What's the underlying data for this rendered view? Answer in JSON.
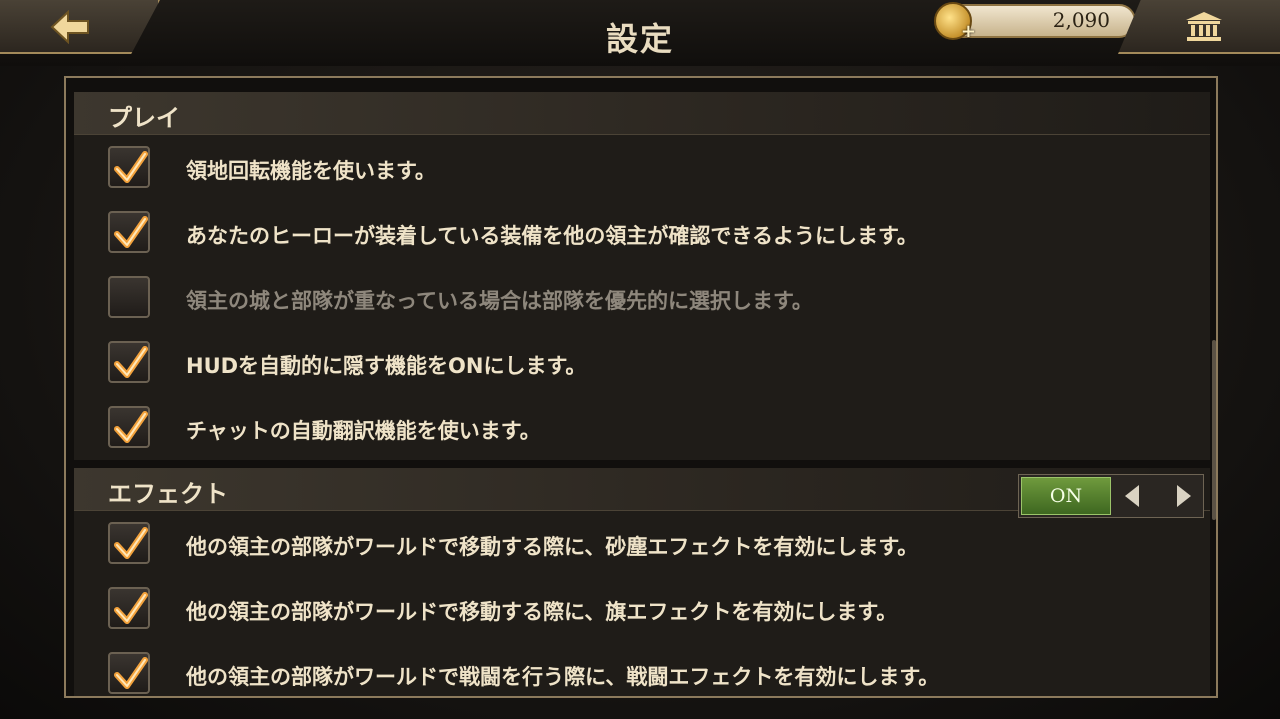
{
  "header": {
    "title": "設定",
    "gold": "2,090"
  },
  "icons": {
    "back": "back-arrow-icon",
    "coin": "gold-coin-plus-icon",
    "bank": "bank-icon",
    "check": "checkmark-icon"
  },
  "colors": {
    "accent_gold": "#e9dcc0",
    "check_orange": "#f3a23c",
    "toggle_green": "#4f7c2a"
  },
  "sections": [
    {
      "title": "プレイ",
      "items": [
        {
          "label": "領地回転機能を使います。",
          "checked": true,
          "enabled": true
        },
        {
          "label": "あなたのヒーローが装着している装備を他の領主が確認できるようにします。",
          "checked": true,
          "enabled": true
        },
        {
          "label": "領主の城と部隊が重なっている場合は部隊を優先的に選択します。",
          "checked": false,
          "enabled": false
        },
        {
          "label": "HUDを自動的に隠す機能をONにします。",
          "checked": true,
          "enabled": true
        },
        {
          "label": "チャットの自動翻訳機能を使います。",
          "checked": true,
          "enabled": true
        }
      ]
    },
    {
      "title": "エフェクト",
      "toggle": "ON",
      "items": [
        {
          "label": "他の領主の部隊がワールドで移動する際に、砂塵エフェクトを有効にします。",
          "checked": true,
          "enabled": true
        },
        {
          "label": "他の領主の部隊がワールドで移動する際に、旗エフェクトを有効にします。",
          "checked": true,
          "enabled": true
        },
        {
          "label": "他の領主の部隊がワールドで戦闘を行う際に、戦闘エフェクトを有効にします。",
          "checked": true,
          "enabled": true
        }
      ]
    }
  ]
}
